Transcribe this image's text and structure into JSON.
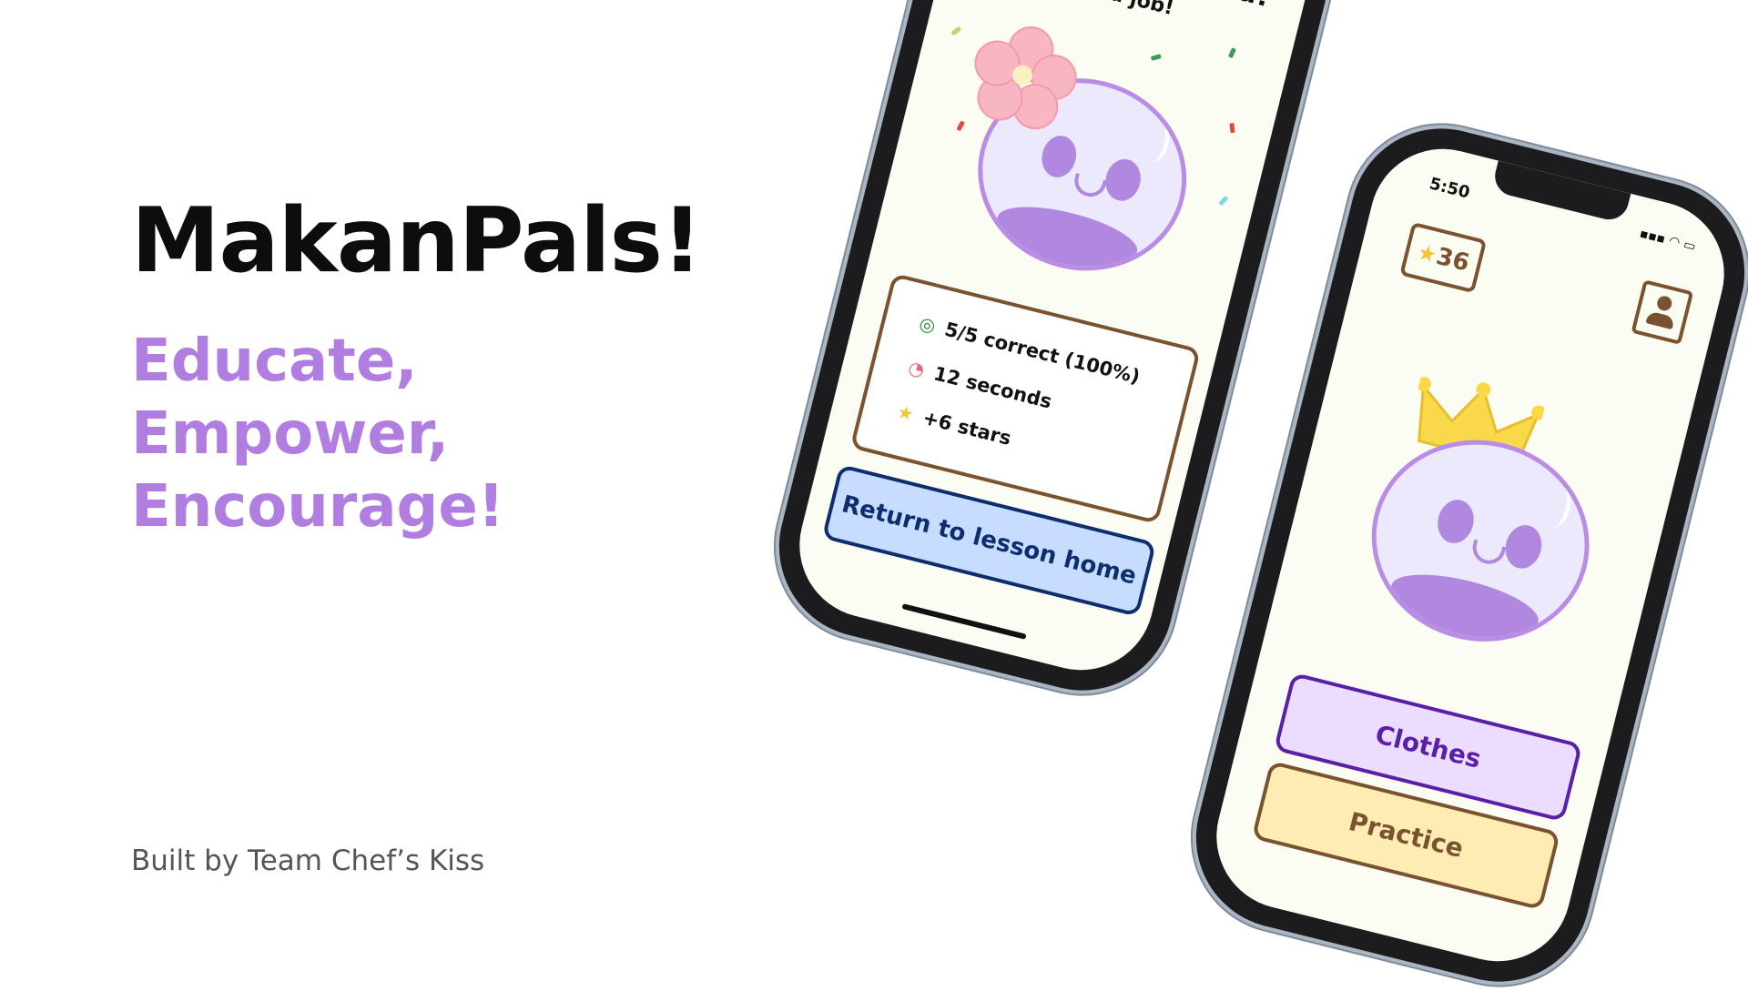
{
  "branding": {
    "app_title": "MakanPals!",
    "taglines": [
      "Educate,",
      "Empower,",
      "Encourage!"
    ],
    "credit": "Built by Team Chef’s Kiss",
    "accent_color": "#b07ee0"
  },
  "lesson_screen": {
    "title": "Lesson completed!",
    "subtitle": "Good job!",
    "stats": [
      {
        "icon": "target-icon",
        "text": "5/5 correct (100%)"
      },
      {
        "icon": "timer-icon",
        "text": "12 seconds"
      },
      {
        "icon": "star-icon",
        "text": "+6 stars"
      }
    ],
    "return_button": "Return to lesson home"
  },
  "home_screen": {
    "status_time": "5:50",
    "star_count": "36",
    "buttons": {
      "clothes": "Clothes",
      "practice": "Practice"
    }
  }
}
